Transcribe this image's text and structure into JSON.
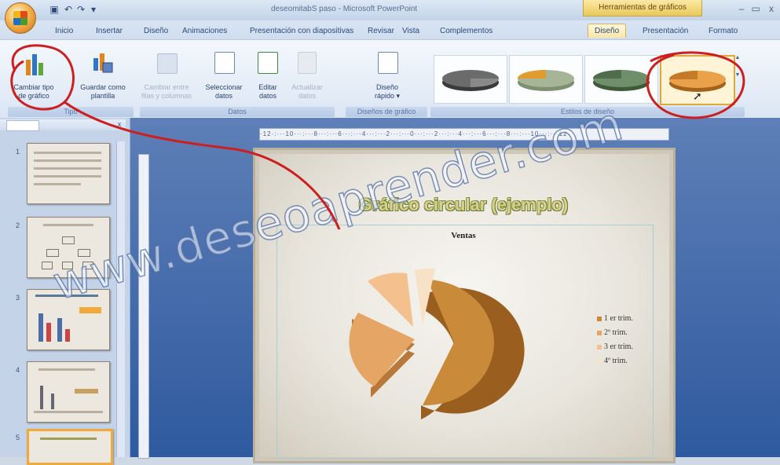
{
  "titlebar": {
    "document_title": "deseomitabS paso - Microsoft PowerPoint",
    "contextual_group": "Herramientas de gráficos",
    "controls": [
      "–",
      "▭",
      "x"
    ]
  },
  "tabs": [
    "Inicio",
    "Insertar",
    "Diseño",
    "Animaciones",
    "Presentación con diapositivas",
    "Revisar",
    "Vista",
    "Complementos",
    "Diseño",
    "Presentación",
    "Formato"
  ],
  "active_tab_index": 8,
  "ribbon": {
    "tipo": {
      "cambiar_tipo": [
        "Cambiar tipo",
        "de gráfico"
      ],
      "guardar_como": [
        "Guardar como",
        "plantilla"
      ],
      "label": "Tipo"
    },
    "datos": {
      "cambiar_entre": [
        "Cambiar entre",
        "filas y columnas"
      ],
      "seleccionar": [
        "Seleccionar",
        "datos"
      ],
      "editar": [
        "Editar",
        "datos"
      ],
      "actualizar": [
        "Actualizar",
        "datos"
      ],
      "label": "Datos"
    },
    "disenos": {
      "diseno_rapido": [
        "Diseño",
        "rápido ▾"
      ],
      "label": "Diseños de gráfico"
    },
    "estilos": {
      "label": "Estilos de diseño",
      "items": [
        "style-dark",
        "style-orange",
        "style-green",
        "style-orange-selected"
      ]
    }
  },
  "left_pane": {
    "slide_numbers": [
      "1",
      "2",
      "3",
      "4",
      "5"
    ]
  },
  "ruler_text": "·12·:···10···:···8···:···6···:···4···:···2···:···0···:···2···:···4···:···6···:···8···:···10···:···12·",
  "slide": {
    "title": "Gráfico circular (ejemplo)",
    "chart_title": "Ventas",
    "legend": [
      "1 er trim.",
      "2º trim.",
      "3 er trim.",
      "4º trim."
    ]
  },
  "colors": {
    "pie_1": "#c98a3a",
    "pie_2": "#e4a565",
    "pie_3": "#f3c08e",
    "pie_4": "#f7e2c8",
    "annotation": "#cc1f1f"
  },
  "watermark": "www.deseoaprender.com"
}
